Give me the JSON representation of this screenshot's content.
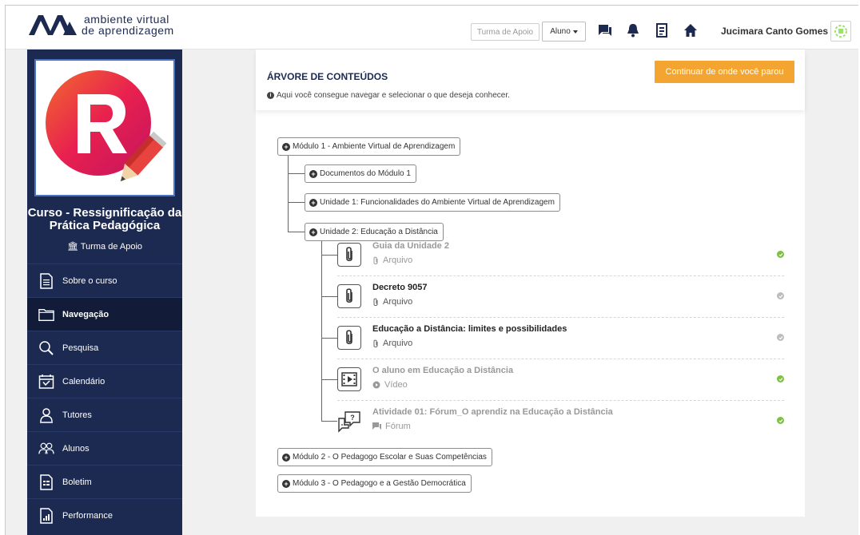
{
  "header": {
    "logo_line1": "ambiente virtual",
    "logo_line2": "de aprendizagem",
    "turma_button": "Turma de Apoio",
    "role_select": "Aluno",
    "icons": [
      "chat-icon",
      "bell-icon",
      "news-icon",
      "home-icon"
    ],
    "user_name": "Jucimara Canto Gomes"
  },
  "sidebar": {
    "course_title": "Curso - Ressignificação da Prática Pedagógica",
    "turma": "Turma de Apoio",
    "items": [
      {
        "label": "Sobre o curso",
        "icon": "document-icon",
        "active": false
      },
      {
        "label": "Navegação",
        "icon": "folder-icon",
        "active": true
      },
      {
        "label": "Pesquisa",
        "icon": "search-icon",
        "active": false
      },
      {
        "label": "Calendário",
        "icon": "calendar-icon",
        "active": false
      },
      {
        "label": "Tutores",
        "icon": "tutor-icon",
        "active": false
      },
      {
        "label": "Alunos",
        "icon": "students-icon",
        "active": false
      },
      {
        "label": "Boletim",
        "icon": "report-icon",
        "active": false
      },
      {
        "label": "Performance",
        "icon": "chart-icon",
        "active": false
      }
    ]
  },
  "content": {
    "title": "ÁRVORE DE CONTEÚDOS",
    "subtitle": "Aqui você consegue navegar e selecionar o que deseja conhecer.",
    "continue_button": "Continuar de onde você parou",
    "modules": [
      "Módulo 1 - Ambiente Virtual de Aprendizagem",
      "Módulo 2 - O Pedagogo Escolar e Suas Competências",
      "Módulo 3 - O Pedagogo e a Gestão Democrática"
    ],
    "module1_children": [
      "Documentos do Módulo 1",
      "Unidade 1: Funcionalidades do Ambiente Virtual de Aprendizagem",
      "Unidade 2: Educação a Distância"
    ],
    "unit2_resources": [
      {
        "title": "Guia da Unidade 2",
        "type": "Arquivo",
        "icon": "paperclip-icon",
        "completed": true
      },
      {
        "title": "Decreto 9057",
        "type": "Arquivo",
        "icon": "paperclip-icon",
        "completed": false
      },
      {
        "title": "Educação a Distância: limites e possibilidades",
        "type": "Arquivo",
        "icon": "paperclip-icon",
        "completed": false
      },
      {
        "title": "O aluno em Educação a Distância",
        "type": "Vídeo",
        "icon": "video-icon",
        "completed": true
      },
      {
        "title": "Atividade 01: Fórum_O aprendiz na Educação a Distância",
        "type": "Fórum",
        "icon": "forum-icon",
        "completed": true
      }
    ],
    "colors": {
      "done": "#7cc142",
      "pending": "#bdbdbd",
      "accent": "#f4a531",
      "navy": "#1c2a52"
    }
  }
}
